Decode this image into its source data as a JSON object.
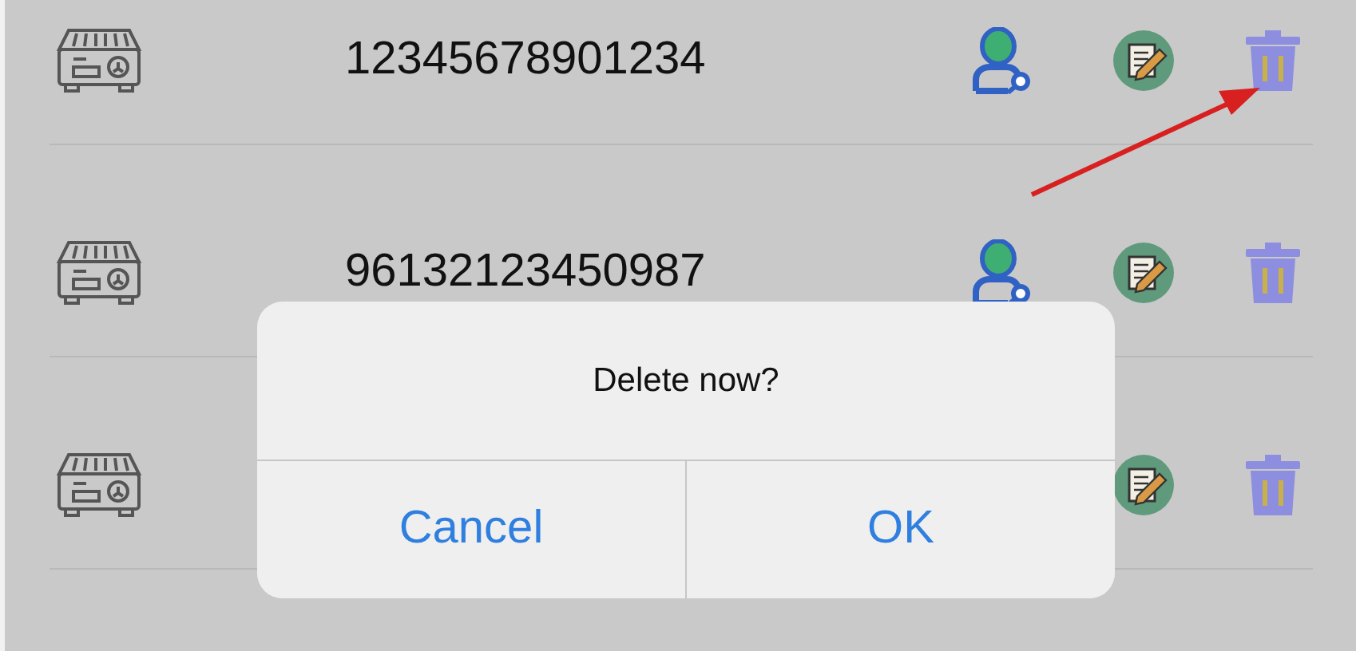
{
  "rows": [
    {
      "number": "12345678901234",
      "show_user": true
    },
    {
      "number": "96132123450987",
      "show_user": true
    },
    {
      "show_user": false
    }
  ],
  "dialog": {
    "message": "Delete now?",
    "buttons": [
      "Cancel",
      "OK"
    ]
  }
}
